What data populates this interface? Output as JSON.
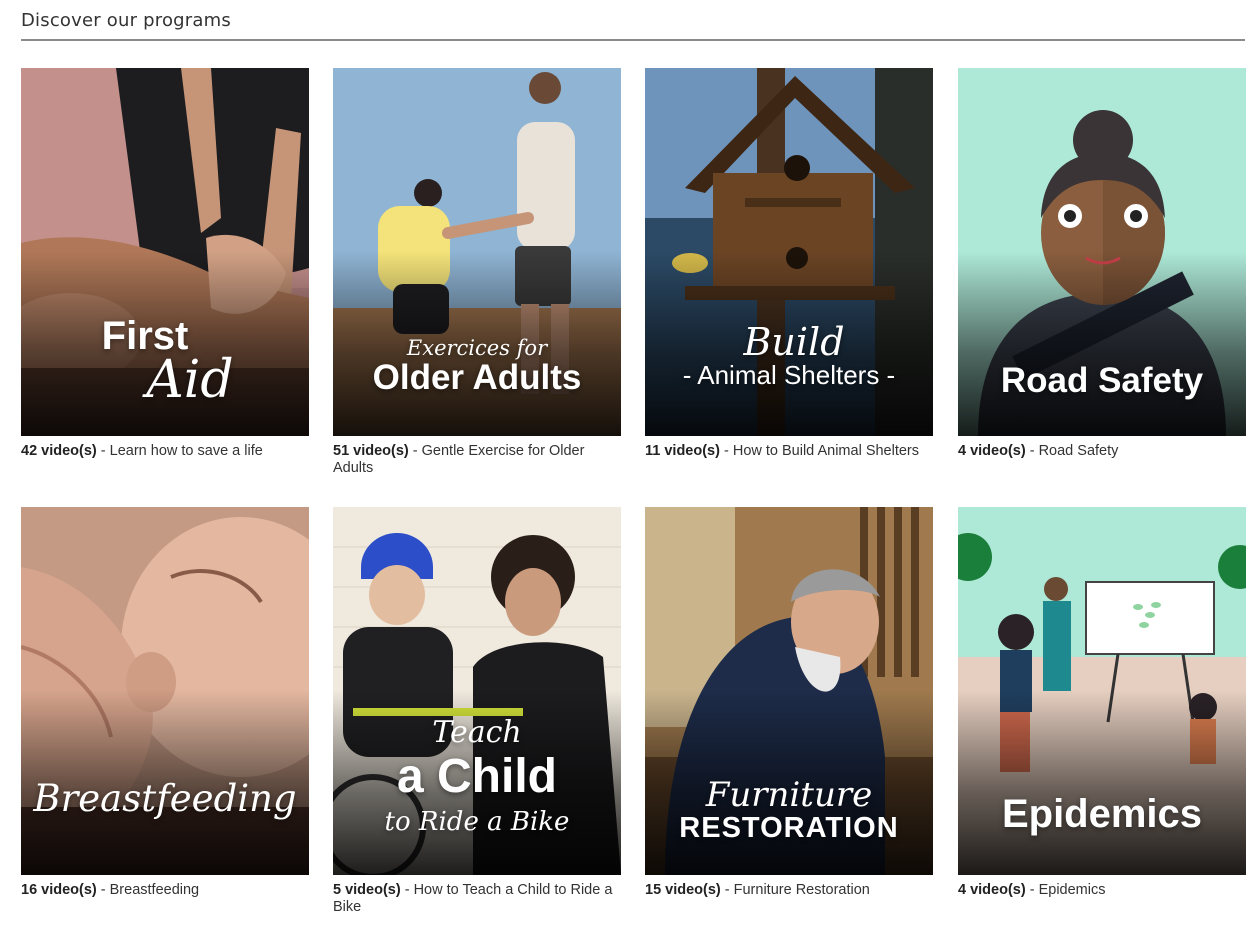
{
  "section": {
    "title": "Discover our programs"
  },
  "programs": [
    {
      "overlay": [
        "First",
        "Aid"
      ],
      "count": "42 video(s)",
      "separator": " - ",
      "description": "Learn how to save a life"
    },
    {
      "overlay": [
        "Exercices for",
        "Older Adults"
      ],
      "count": "51 video(s)",
      "separator": " - ",
      "description": "Gentle Exercise for Older Adults"
    },
    {
      "overlay": [
        "Build",
        "- Animal Shelters -"
      ],
      "count": "11 video(s)",
      "separator": " - ",
      "description": "How to Build Animal Shelters"
    },
    {
      "overlay": [
        "Road Safety"
      ],
      "count": "4 video(s)",
      "separator": " - ",
      "description": "Road Safety"
    },
    {
      "overlay": [
        "Breastfeeding"
      ],
      "count": "16 video(s)",
      "separator": " - ",
      "description": "Breastfeeding"
    },
    {
      "overlay": [
        "Teach",
        "a Child",
        "to Ride a Bike"
      ],
      "count": "5 video(s)",
      "separator": " - ",
      "description": "How to Teach a Child to Ride a Bike"
    },
    {
      "overlay": [
        "Furniture",
        "RESTORATION"
      ],
      "count": "15 video(s)",
      "separator": " - ",
      "description": "Furniture Restoration"
    },
    {
      "overlay": [
        "Epidemics"
      ],
      "count": "4 video(s)",
      "separator": " - ",
      "description": "Epidemics"
    }
  ]
}
